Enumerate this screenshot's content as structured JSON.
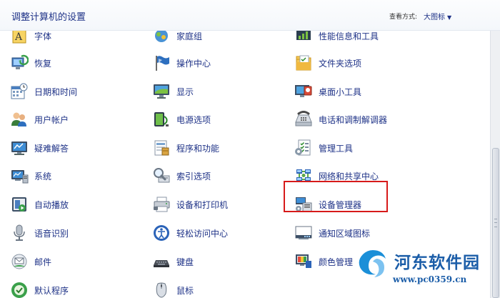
{
  "header": {
    "title": "调整计算机的设置",
    "view_by_label": "查看方式:",
    "view_by_value": "大图标"
  },
  "items": [
    {
      "label": "字体",
      "icon": "fonts-icon"
    },
    {
      "label": "家庭组",
      "icon": "homegroup-icon"
    },
    {
      "label": "性能信息和工具",
      "icon": "performance-icon"
    },
    {
      "label": "恢复",
      "icon": "recovery-icon"
    },
    {
      "label": "操作中心",
      "icon": "action-center-flag-icon"
    },
    {
      "label": "文件夹选项",
      "icon": "folder-options-icon"
    },
    {
      "label": "日期和时间",
      "icon": "date-time-icon"
    },
    {
      "label": "显示",
      "icon": "display-monitor-icon"
    },
    {
      "label": "桌面小工具",
      "icon": "desktop-gadgets-icon"
    },
    {
      "label": "用户帐户",
      "icon": "user-accounts-icon"
    },
    {
      "label": "电源选项",
      "icon": "power-options-icon"
    },
    {
      "label": "电话和调制解调器",
      "icon": "phone-modem-icon"
    },
    {
      "label": "疑难解答",
      "icon": "troubleshooting-icon"
    },
    {
      "label": "程序和功能",
      "icon": "programs-features-icon"
    },
    {
      "label": "管理工具",
      "icon": "administrative-tools-icon"
    },
    {
      "label": "系统",
      "icon": "system-icon"
    },
    {
      "label": "索引选项",
      "icon": "indexing-options-icon"
    },
    {
      "label": "网络和共享中心",
      "icon": "network-sharing-icon"
    },
    {
      "label": "自动播放",
      "icon": "autoplay-icon"
    },
    {
      "label": "设备和打印机",
      "icon": "devices-printers-icon"
    },
    {
      "label": "设备管理器",
      "icon": "device-manager-icon"
    },
    {
      "label": "语音识别",
      "icon": "speech-recognition-icon"
    },
    {
      "label": "轻松访问中心",
      "icon": "ease-of-access-icon"
    },
    {
      "label": "通知区域图标",
      "icon": "notification-area-icon"
    },
    {
      "label": "邮件",
      "icon": "mail-icon"
    },
    {
      "label": "键盘",
      "icon": "keyboard-icon"
    },
    {
      "label": "颜色管理",
      "icon": "color-management-icon"
    },
    {
      "label": "默认程序",
      "icon": "default-programs-icon"
    },
    {
      "label": "鼠标",
      "icon": "mouse-icon"
    }
  ],
  "highlighted_item": "网络和共享中心",
  "watermark": {
    "title": "河东软件园",
    "url": "www.pc0359.cn"
  },
  "colors": {
    "link_text": "#1e3287",
    "highlight_border": "#d71a1a",
    "watermark": "#1b5da8"
  }
}
